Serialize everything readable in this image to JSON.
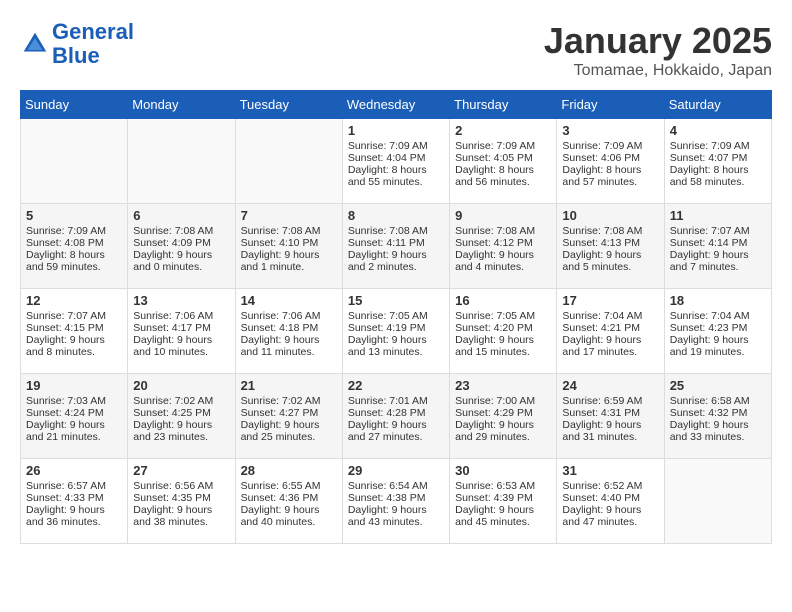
{
  "header": {
    "logo_line1": "General",
    "logo_line2": "Blue",
    "title": "January 2025",
    "subtitle": "Tomamae, Hokkaido, Japan"
  },
  "days_of_week": [
    "Sunday",
    "Monday",
    "Tuesday",
    "Wednesday",
    "Thursday",
    "Friday",
    "Saturday"
  ],
  "weeks": [
    [
      {
        "day": "",
        "content": ""
      },
      {
        "day": "",
        "content": ""
      },
      {
        "day": "",
        "content": ""
      },
      {
        "day": "1",
        "content": "Sunrise: 7:09 AM\nSunset: 4:04 PM\nDaylight: 8 hours\nand 55 minutes."
      },
      {
        "day": "2",
        "content": "Sunrise: 7:09 AM\nSunset: 4:05 PM\nDaylight: 8 hours\nand 56 minutes."
      },
      {
        "day": "3",
        "content": "Sunrise: 7:09 AM\nSunset: 4:06 PM\nDaylight: 8 hours\nand 57 minutes."
      },
      {
        "day": "4",
        "content": "Sunrise: 7:09 AM\nSunset: 4:07 PM\nDaylight: 8 hours\nand 58 minutes."
      }
    ],
    [
      {
        "day": "5",
        "content": "Sunrise: 7:09 AM\nSunset: 4:08 PM\nDaylight: 8 hours\nand 59 minutes."
      },
      {
        "day": "6",
        "content": "Sunrise: 7:08 AM\nSunset: 4:09 PM\nDaylight: 9 hours\nand 0 minutes."
      },
      {
        "day": "7",
        "content": "Sunrise: 7:08 AM\nSunset: 4:10 PM\nDaylight: 9 hours\nand 1 minute."
      },
      {
        "day": "8",
        "content": "Sunrise: 7:08 AM\nSunset: 4:11 PM\nDaylight: 9 hours\nand 2 minutes."
      },
      {
        "day": "9",
        "content": "Sunrise: 7:08 AM\nSunset: 4:12 PM\nDaylight: 9 hours\nand 4 minutes."
      },
      {
        "day": "10",
        "content": "Sunrise: 7:08 AM\nSunset: 4:13 PM\nDaylight: 9 hours\nand 5 minutes."
      },
      {
        "day": "11",
        "content": "Sunrise: 7:07 AM\nSunset: 4:14 PM\nDaylight: 9 hours\nand 7 minutes."
      }
    ],
    [
      {
        "day": "12",
        "content": "Sunrise: 7:07 AM\nSunset: 4:15 PM\nDaylight: 9 hours\nand 8 minutes."
      },
      {
        "day": "13",
        "content": "Sunrise: 7:06 AM\nSunset: 4:17 PM\nDaylight: 9 hours\nand 10 minutes."
      },
      {
        "day": "14",
        "content": "Sunrise: 7:06 AM\nSunset: 4:18 PM\nDaylight: 9 hours\nand 11 minutes."
      },
      {
        "day": "15",
        "content": "Sunrise: 7:05 AM\nSunset: 4:19 PM\nDaylight: 9 hours\nand 13 minutes."
      },
      {
        "day": "16",
        "content": "Sunrise: 7:05 AM\nSunset: 4:20 PM\nDaylight: 9 hours\nand 15 minutes."
      },
      {
        "day": "17",
        "content": "Sunrise: 7:04 AM\nSunset: 4:21 PM\nDaylight: 9 hours\nand 17 minutes."
      },
      {
        "day": "18",
        "content": "Sunrise: 7:04 AM\nSunset: 4:23 PM\nDaylight: 9 hours\nand 19 minutes."
      }
    ],
    [
      {
        "day": "19",
        "content": "Sunrise: 7:03 AM\nSunset: 4:24 PM\nDaylight: 9 hours\nand 21 minutes."
      },
      {
        "day": "20",
        "content": "Sunrise: 7:02 AM\nSunset: 4:25 PM\nDaylight: 9 hours\nand 23 minutes."
      },
      {
        "day": "21",
        "content": "Sunrise: 7:02 AM\nSunset: 4:27 PM\nDaylight: 9 hours\nand 25 minutes."
      },
      {
        "day": "22",
        "content": "Sunrise: 7:01 AM\nSunset: 4:28 PM\nDaylight: 9 hours\nand 27 minutes."
      },
      {
        "day": "23",
        "content": "Sunrise: 7:00 AM\nSunset: 4:29 PM\nDaylight: 9 hours\nand 29 minutes."
      },
      {
        "day": "24",
        "content": "Sunrise: 6:59 AM\nSunset: 4:31 PM\nDaylight: 9 hours\nand 31 minutes."
      },
      {
        "day": "25",
        "content": "Sunrise: 6:58 AM\nSunset: 4:32 PM\nDaylight: 9 hours\nand 33 minutes."
      }
    ],
    [
      {
        "day": "26",
        "content": "Sunrise: 6:57 AM\nSunset: 4:33 PM\nDaylight: 9 hours\nand 36 minutes."
      },
      {
        "day": "27",
        "content": "Sunrise: 6:56 AM\nSunset: 4:35 PM\nDaylight: 9 hours\nand 38 minutes."
      },
      {
        "day": "28",
        "content": "Sunrise: 6:55 AM\nSunset: 4:36 PM\nDaylight: 9 hours\nand 40 minutes."
      },
      {
        "day": "29",
        "content": "Sunrise: 6:54 AM\nSunset: 4:38 PM\nDaylight: 9 hours\nand 43 minutes."
      },
      {
        "day": "30",
        "content": "Sunrise: 6:53 AM\nSunset: 4:39 PM\nDaylight: 9 hours\nand 45 minutes."
      },
      {
        "day": "31",
        "content": "Sunrise: 6:52 AM\nSunset: 4:40 PM\nDaylight: 9 hours\nand 47 minutes."
      },
      {
        "day": "",
        "content": ""
      }
    ]
  ]
}
